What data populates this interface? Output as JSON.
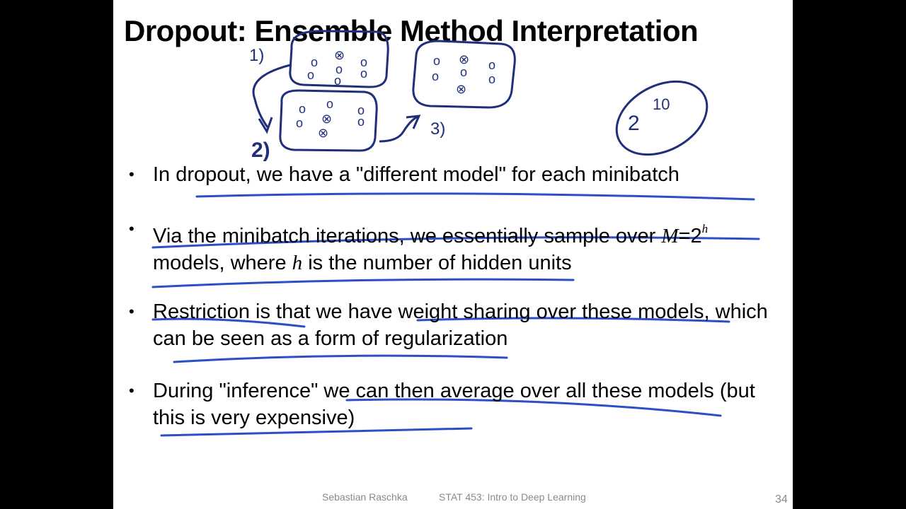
{
  "slide": {
    "title": "Dropout: Ensemble Method Interpretation",
    "bullets": [
      {
        "text": "In dropout, we have a \"different model\" for each minibatch"
      },
      {
        "part1": "Via the minibatch iterations, we essentially sample over ",
        "math_M": "M",
        "math_eq": "=",
        "math_base": "2",
        "math_exp": "h",
        "part2": "models, where ",
        "math_h": "h",
        "part3": " is the number of hidden units"
      },
      {
        "text": "Restriction is that we have weight sharing over these models, which can be seen as a form of regularization"
      },
      {
        "text": "During \"inference\" we can then average over all these models (but this is very expensive)"
      }
    ],
    "footer": {
      "author": "Sebastian Raschka",
      "course": "STAT 453: Intro to Deep Learning",
      "page": "34"
    }
  },
  "annotations": {
    "labels": [
      "1)",
      "2)",
      "3)"
    ],
    "power_base": "2",
    "power_exp": "10",
    "crossed_symbol": "⊗",
    "circle_symbol": "o",
    "ink_color": "#1f2f7a",
    "underline_color": "#2b4fc7"
  }
}
